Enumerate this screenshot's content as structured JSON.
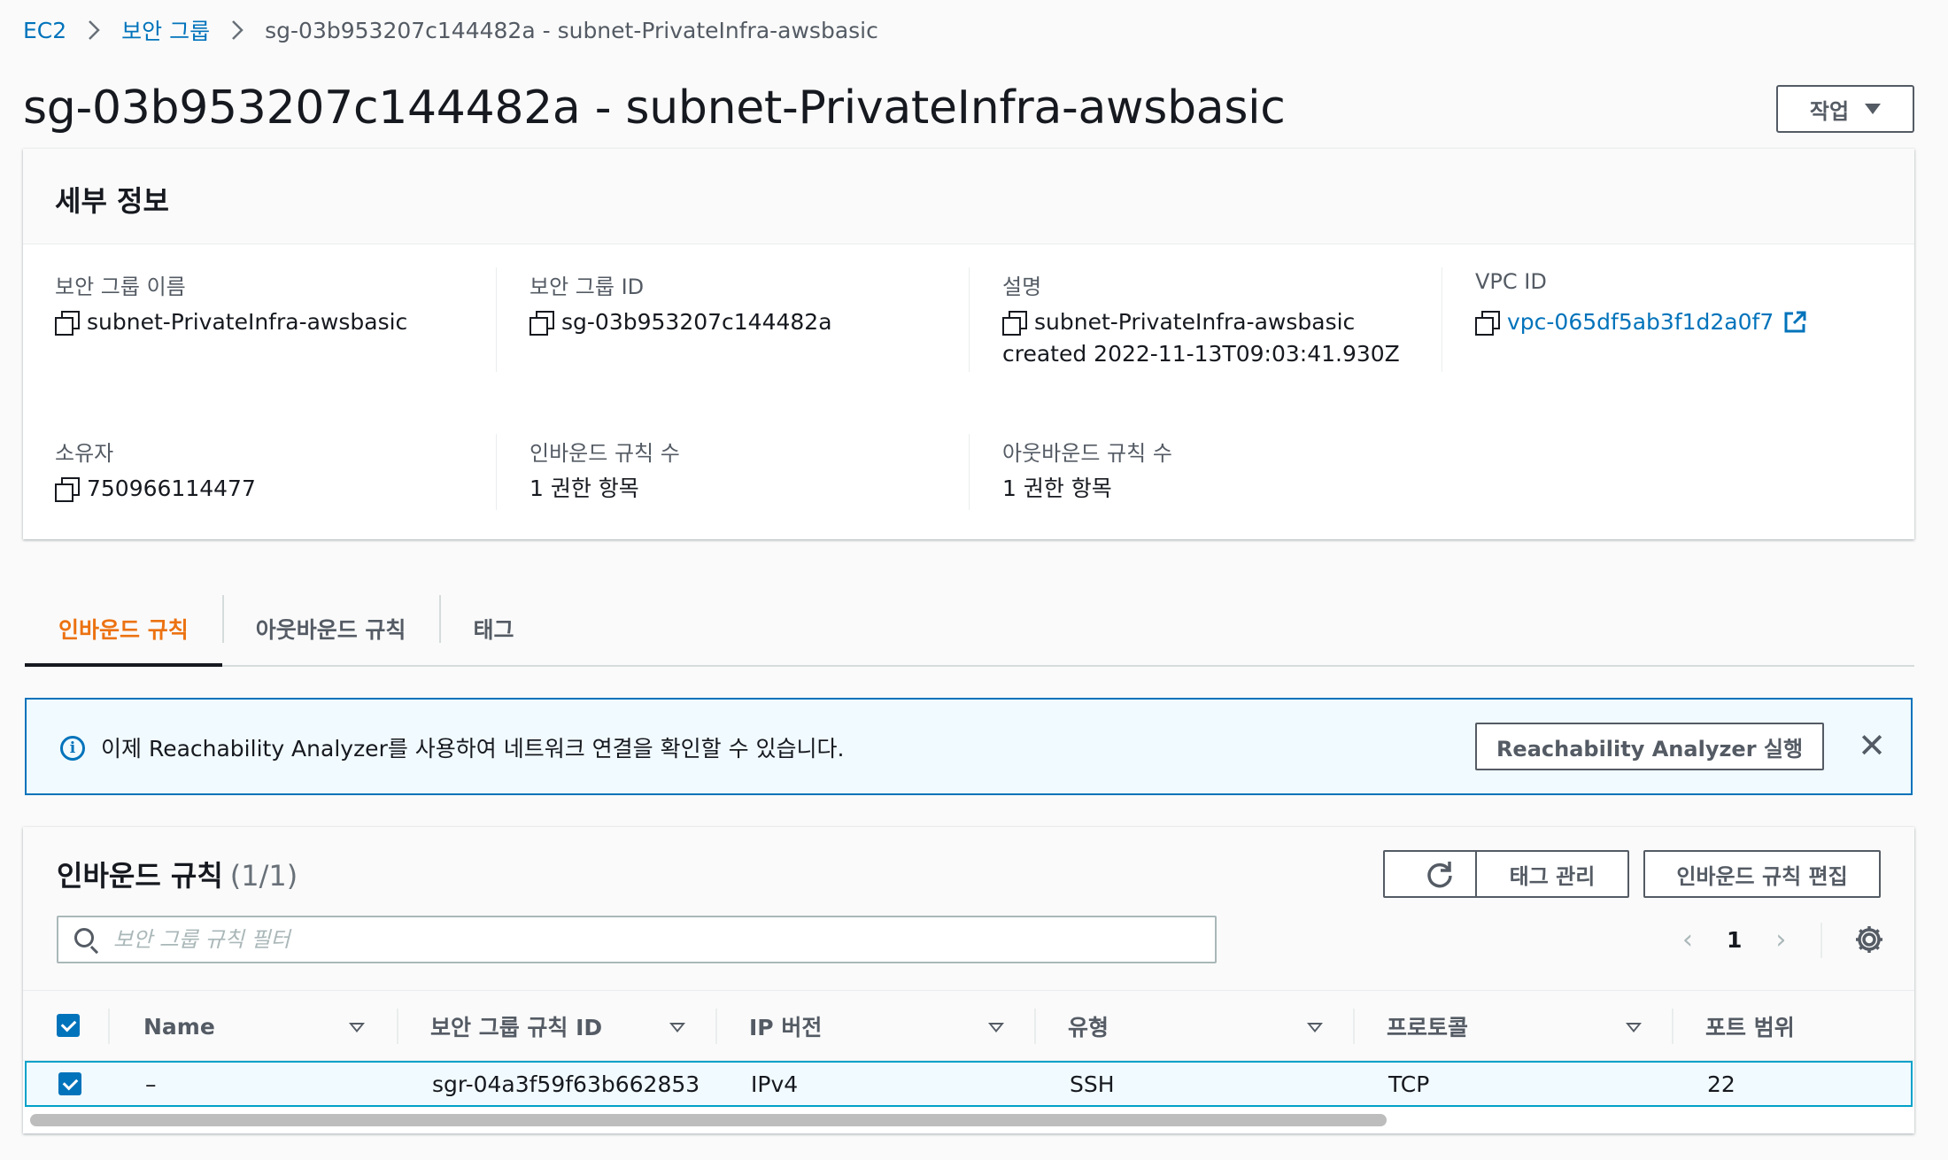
{
  "breadcrumb": {
    "items": [
      "EC2",
      "보안 그룹"
    ],
    "current": "sg-03b953207c144482a - subnet-PrivateInfra-awsbasic"
  },
  "page_title": "sg-03b953207c144482a - subnet-PrivateInfra-awsbasic",
  "actions_label": "작업",
  "details": {
    "heading": "세부 정보",
    "sg_name_label": "보안 그룹 이름",
    "sg_name": "subnet-PrivateInfra-awsbasic",
    "sg_id_label": "보안 그룹 ID",
    "sg_id": "sg-03b953207c144482a",
    "desc_label": "설명",
    "desc_line1": "subnet-PrivateInfra-awsbasic",
    "desc_line2": "created 2022-11-13T09:03:41.930Z",
    "vpc_label": "VPC ID",
    "vpc_id": "vpc-065df5ab3f1d2a0f7",
    "owner_label": "소유자",
    "owner": "750966114477",
    "inbound_count_label": "인바운드 규칙 수",
    "inbound_count": "1 권한 항목",
    "outbound_count_label": "아웃바운드 규칙 수",
    "outbound_count": "1 권한 항목"
  },
  "tabs": [
    "인바운드 규칙",
    "아웃바운드 규칙",
    "태그"
  ],
  "banner": {
    "message": "이제 Reachability Analyzer를 사용하여 네트워크 연결을 확인할 수 있습니다.",
    "button": "Reachability Analyzer 실행",
    "close": "✕"
  },
  "rules": {
    "title": "인바운드 규칙",
    "count": "(1/1)",
    "manage_tags": "태그 관리",
    "edit_rules": "인바운드 규칙 편집",
    "search_placeholder": "보안 그룹 규칙 필터",
    "page": "1",
    "prev": "‹",
    "next": "›",
    "columns": [
      "Name",
      "보안 그룹 규칙 ID",
      "IP 버전",
      "유형",
      "프로토콜",
      "포트 범위"
    ],
    "rows": [
      [
        "–",
        "sgr-04a3f59f63b662853",
        "IPv4",
        "SSH",
        "TCP",
        "22"
      ]
    ]
  }
}
